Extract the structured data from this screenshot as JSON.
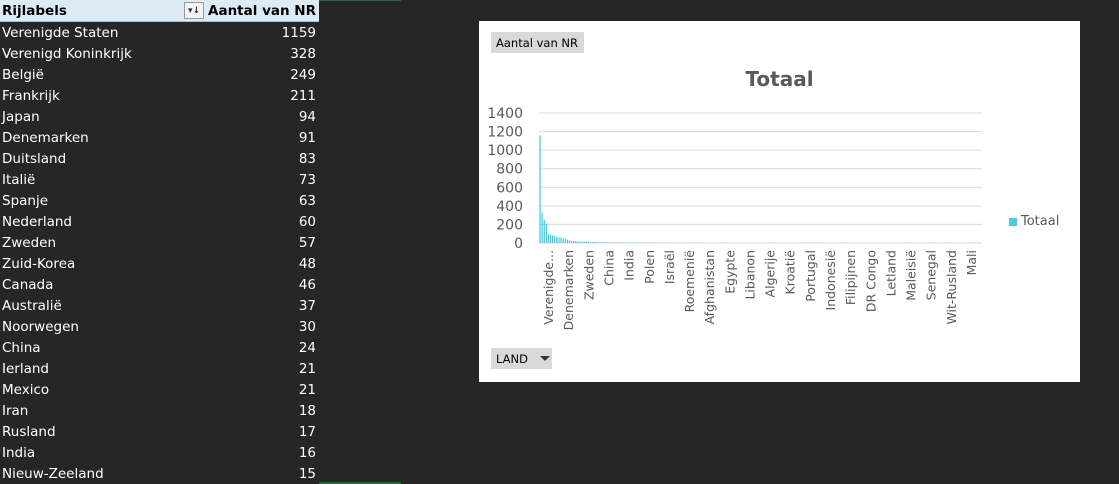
{
  "pivot": {
    "row_label_header": "Rijlabels",
    "value_header": "Aantal van NR",
    "filter_icon": "sort-filter-icon",
    "rows": [
      {
        "label": "Verenigde Staten",
        "value": "1159"
      },
      {
        "label": "Verenigd Koninkrijk",
        "value": "328"
      },
      {
        "label": "België",
        "value": "249"
      },
      {
        "label": "Frankrijk",
        "value": "211"
      },
      {
        "label": "Japan",
        "value": "94"
      },
      {
        "label": "Denemarken",
        "value": "91"
      },
      {
        "label": "Duitsland",
        "value": "83"
      },
      {
        "label": "Italië",
        "value": "73"
      },
      {
        "label": "Spanje",
        "value": "63"
      },
      {
        "label": "Nederland",
        "value": "60"
      },
      {
        "label": "Zweden",
        "value": "57"
      },
      {
        "label": "Zuid-Korea",
        "value": "48"
      },
      {
        "label": "Canada",
        "value": "46"
      },
      {
        "label": "Australië",
        "value": "37"
      },
      {
        "label": "Noorwegen",
        "value": "30"
      },
      {
        "label": "China",
        "value": "24"
      },
      {
        "label": "Ierland",
        "value": "21"
      },
      {
        "label": "Mexico",
        "value": "21"
      },
      {
        "label": "Iran",
        "value": "18"
      },
      {
        "label": "Rusland",
        "value": "17"
      },
      {
        "label": "India",
        "value": "16"
      },
      {
        "label": "Nieuw-Zeeland",
        "value": "15"
      }
    ]
  },
  "chart_panel": {
    "value_field_button": "Aantal van NR",
    "axis_field_button": "LAND",
    "axis_field_icon": "dropdown-arrow-icon"
  },
  "chart_data": {
    "type": "bar",
    "title": "Totaal",
    "xlabel": "",
    "ylabel": "",
    "ylim": [
      0,
      1400
    ],
    "yticks": [
      0,
      200,
      400,
      600,
      800,
      1000,
      1200,
      1400
    ],
    "grid": true,
    "legend": "right",
    "bar_color": "#4bc8e6",
    "categories": [
      "Verenigde...",
      "Denemarken",
      "Zweden",
      "China",
      "India",
      "Polen",
      "Israël",
      "Roemenië",
      "Afghanistan",
      "Egypte",
      "Libanon",
      "Algerije",
      "Kroatië",
      "Portugal",
      "Indonesië",
      "Filipijnen",
      "DR Congo",
      "Letland",
      "Maleisië",
      "Senegal",
      "Wit-Rusland",
      "Mali"
    ],
    "series": [
      {
        "name": "Totaal",
        "values": [
          1159,
          328,
          249,
          211,
          94,
          91,
          83,
          73,
          63,
          60,
          57,
          48,
          46,
          37,
          30,
          24,
          21,
          21,
          18,
          17,
          16,
          15,
          14,
          13,
          12,
          11,
          10,
          10,
          9,
          9,
          8,
          8,
          7,
          7,
          7,
          6,
          6,
          6,
          5,
          5,
          5,
          5,
          4,
          4,
          4,
          4,
          4,
          3,
          3,
          3,
          3,
          3,
          3,
          3,
          2,
          2,
          2,
          2,
          2,
          2,
          2,
          2,
          2,
          2,
          2,
          2,
          2,
          2,
          2,
          2,
          2,
          1,
          1,
          1,
          1,
          1,
          1,
          1,
          1,
          1,
          1,
          1,
          1,
          1,
          1,
          1,
          1,
          1,
          1,
          1,
          1,
          1,
          1,
          1,
          1,
          1,
          1,
          1,
          1,
          1,
          1,
          1,
          1,
          1,
          1,
          1,
          1,
          1,
          1,
          1,
          1,
          1,
          1,
          1,
          1,
          1,
          1,
          1,
          1,
          1,
          1,
          1,
          1,
          1,
          1,
          1,
          1,
          1,
          1,
          1,
          1,
          1,
          1,
          1,
          1,
          1,
          1,
          1,
          1,
          1,
          1,
          1,
          1,
          1,
          1,
          1,
          1,
          1,
          1,
          1,
          1,
          1,
          1,
          1,
          1,
          1,
          1,
          1,
          1,
          1,
          1,
          1,
          1,
          1,
          1,
          1,
          1,
          1,
          1,
          1,
          1,
          1,
          1,
          1,
          1,
          1,
          1,
          1,
          1,
          1,
          1,
          1,
          1,
          1,
          1,
          1,
          1,
          1,
          1,
          1,
          1,
          1,
          1,
          1,
          1,
          1,
          1,
          1,
          1,
          1,
          1,
          1,
          1,
          1,
          1,
          1,
          1,
          1,
          1,
          1,
          1
        ]
      }
    ]
  }
}
